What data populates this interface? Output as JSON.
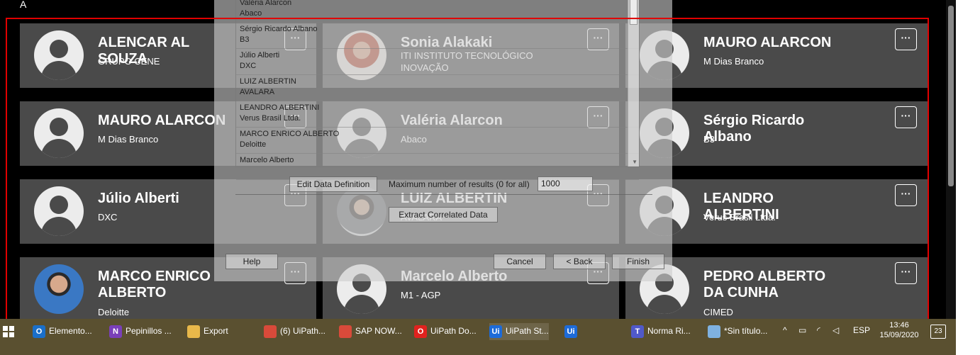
{
  "top_letter": "A",
  "contacts": [
    {
      "name": "ALENCAR AL SOUZA",
      "company": "GRUPO CENE",
      "line2": "",
      "photo": false
    },
    {
      "name": "Sonia Alakaki",
      "company": "ITI INSTITUTO TECNOLÓGICO",
      "line2": "INOVAÇÃO",
      "photo": true
    },
    {
      "name": "MAURO ALARCON",
      "company": "M Dias Branco",
      "line2": "",
      "photo": false
    },
    {
      "name": "MAURO ALARCON",
      "company": "M Dias Branco",
      "line2": "",
      "photo": false
    },
    {
      "name": "Valéria Alarcon",
      "company": "Abaco",
      "line2": "",
      "photo": false
    },
    {
      "name": "Sérgio Ricardo Albano",
      "company": "B3",
      "line2": "",
      "photo": false
    },
    {
      "name": "Júlio Alberti",
      "company": "DXC",
      "line2": "",
      "photo": false
    },
    {
      "name": "LUIZ ALBERTIN",
      "company": "AVALARA",
      "line2": "",
      "photo": true
    },
    {
      "name": "LEANDRO ALBERTINI",
      "company": "Verus Brasil Ltda.",
      "line2": "",
      "photo": false
    },
    {
      "name": "MARCO ENRICO ALBERTO",
      "company": "Deloitte",
      "line2": "",
      "photo": true
    },
    {
      "name": "Marcelo Alberto",
      "company": "M1 - AGP",
      "line2": "",
      "photo": false
    },
    {
      "name": "PEDRO ALBERTO DA CUNHA",
      "company": "CIMED",
      "line2": "",
      "photo": false
    }
  ],
  "more_button_label": "···",
  "dialog": {
    "list_items": [
      {
        "name": "Valéria Alarcon",
        "company": "Abaco"
      },
      {
        "name": "Sérgio Ricardo Albano",
        "company": "B3"
      },
      {
        "name": "Júlio Alberti",
        "company": "DXC"
      },
      {
        "name": "LUIZ ALBERTIN",
        "company": "AVALARA"
      },
      {
        "name": "LEANDRO ALBERTINI",
        "company": "Verus Brasil Ltda."
      },
      {
        "name": "MARCO ENRICO ALBERTO",
        "company": "Deloitte"
      },
      {
        "name": "Marcelo Alberto",
        "company": ""
      }
    ],
    "edit_button": "Edit Data Definition",
    "max_results_label": "Maximum number of results (0 for all)",
    "max_results_value": "1000",
    "extract_button": "Extract Correlated Data",
    "help_button": "Help",
    "cancel_button": "Cancel",
    "back_button": "< Back",
    "finish_button": "Finish"
  },
  "taskbar": {
    "items": [
      {
        "label": "Elemento...",
        "icon": "outlook-icon",
        "color": "#1a6fc9",
        "glyph": "O"
      },
      {
        "label": "Pepinillos ...",
        "icon": "onenote-icon",
        "color": "#7a3fb8",
        "glyph": "N"
      },
      {
        "label": "Export",
        "icon": "folder-icon",
        "color": "#e8b84a",
        "glyph": ""
      },
      {
        "label": "(6) UiPath...",
        "icon": "chrome-icon",
        "color": "#d94a3a",
        "glyph": ""
      },
      {
        "label": "SAP NOW...",
        "icon": "chrome-icon",
        "color": "#d94a3a",
        "glyph": ""
      },
      {
        "label": "UiPath Do...",
        "icon": "opera-icon",
        "color": "#e0221e",
        "glyph": "O"
      },
      {
        "label": "UiPath St...",
        "icon": "uipath-icon",
        "color": "#1d6bd8",
        "glyph": "Ui"
      },
      {
        "label": "",
        "icon": "uipath-icon",
        "color": "#1d6bd8",
        "glyph": "Ui"
      },
      {
        "label": "Norma Ri...",
        "icon": "teams-icon",
        "color": "#5059c9",
        "glyph": "T"
      },
      {
        "label": "*Sin título...",
        "icon": "paint-icon",
        "color": "#7fb2e0",
        "glyph": ""
      }
    ],
    "tray": {
      "language": "ESP",
      "time": "13:46",
      "date": "15/09/2020",
      "notifications": "23"
    }
  }
}
